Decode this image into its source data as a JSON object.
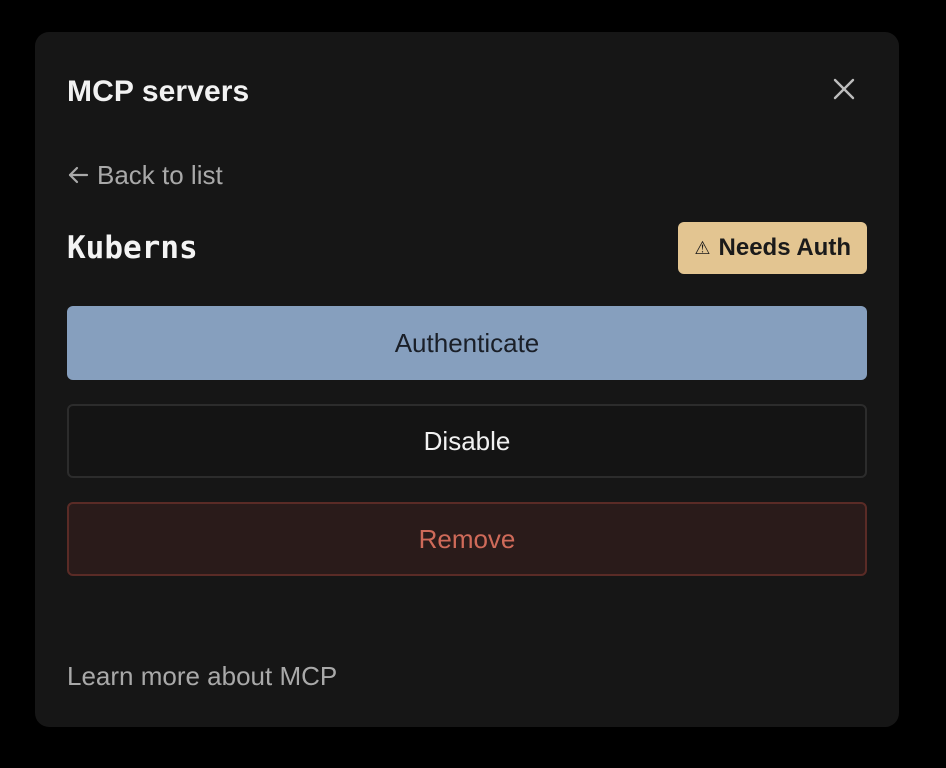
{
  "dialog": {
    "title": "MCP servers",
    "close_icon": "close-icon"
  },
  "nav": {
    "back_icon": "arrow-left-icon",
    "back_label": "Back to list"
  },
  "server": {
    "name": "Kuberns",
    "status_icon": "warning-icon",
    "status_icon_glyph": "⚠",
    "status_label": "Needs Auth"
  },
  "actions": {
    "authenticate_label": "Authenticate",
    "disable_label": "Disable",
    "remove_label": "Remove"
  },
  "footer": {
    "learn_more_label": "Learn more about MCP"
  },
  "colors": {
    "background": "#000000",
    "panel": "#161616",
    "badge": "#e3c591",
    "primary_button": "#869fbe",
    "danger_text": "#cf6a59",
    "danger_border": "#5a2b26"
  }
}
